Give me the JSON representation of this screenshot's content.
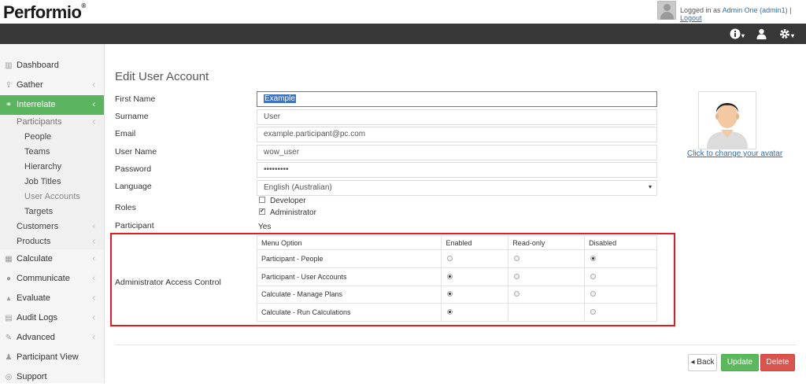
{
  "header": {
    "logo": "Performio",
    "logged_in_prefix": "Logged in as",
    "user": "Admin One (admin1)",
    "separator": "|",
    "logout": "Logout"
  },
  "toolbar": {
    "icons": [
      "info-icon",
      "user-icon",
      "gear-icon"
    ]
  },
  "sidebar": {
    "items": [
      {
        "label": "Dashboard",
        "icon": "chart-icon"
      },
      {
        "label": "Gather",
        "icon": "upload-icon"
      },
      {
        "label": "Interrelate",
        "icon": "link-icon"
      },
      {
        "label": "Participants"
      },
      {
        "label": "People"
      },
      {
        "label": "Teams"
      },
      {
        "label": "Hierarchy"
      },
      {
        "label": "Job Titles"
      },
      {
        "label": "User Accounts"
      },
      {
        "label": "Targets"
      },
      {
        "label": "Customers"
      },
      {
        "label": "Products"
      },
      {
        "label": "Calculate",
        "icon": "calculator-icon"
      },
      {
        "label": "Communicate",
        "icon": "comments-icon"
      },
      {
        "label": "Evaluate",
        "icon": "thumbs-up-icon"
      },
      {
        "label": "Audit Logs",
        "icon": "file-icon"
      },
      {
        "label": "Advanced",
        "icon": "wrench-icon"
      },
      {
        "label": "Participant View",
        "icon": "user-icon"
      },
      {
        "label": "Support",
        "icon": "support-icon"
      }
    ]
  },
  "form": {
    "title": "Edit User Account",
    "first_name_label": "First Name",
    "first_name_value": "Example",
    "surname_label": "Surname",
    "surname_value": "User",
    "email_label": "Email",
    "email_value": "example.participant@pc.com",
    "username_label": "User Name",
    "username_value": "wow_user",
    "password_label": "Password",
    "password_value": "•••••••••",
    "language_label": "Language",
    "language_value": "English (Australian)",
    "roles_label": "Roles",
    "role_developer": "Developer",
    "role_administrator": "Administrator",
    "participant_label": "Participant",
    "participant_value": "Yes",
    "acl_label": "Administrator Access Control"
  },
  "acl": {
    "headers": [
      "Menu Option",
      "Enabled",
      "Read-only",
      "Disabled"
    ],
    "rows": [
      {
        "option": "Participant - People",
        "selected": "disabled",
        "readonly_available": true
      },
      {
        "option": "Participant - User Accounts",
        "selected": "enabled",
        "readonly_available": true
      },
      {
        "option": "Calculate - Manage Plans",
        "selected": "enabled",
        "readonly_available": true
      },
      {
        "option": "Calculate - Run Calculations",
        "selected": "enabled",
        "readonly_available": false
      }
    ]
  },
  "avatar": {
    "change_link": "Click to change your avatar"
  },
  "buttons": {
    "back": "◂ Back",
    "update": "Update",
    "delete": "Delete"
  },
  "colors": {
    "active_nav": "#5ab55e",
    "top_dark_bar": "#373737",
    "highlight_border": "#e31c24",
    "update": "#5cb85c",
    "delete": "#d9534f"
  }
}
